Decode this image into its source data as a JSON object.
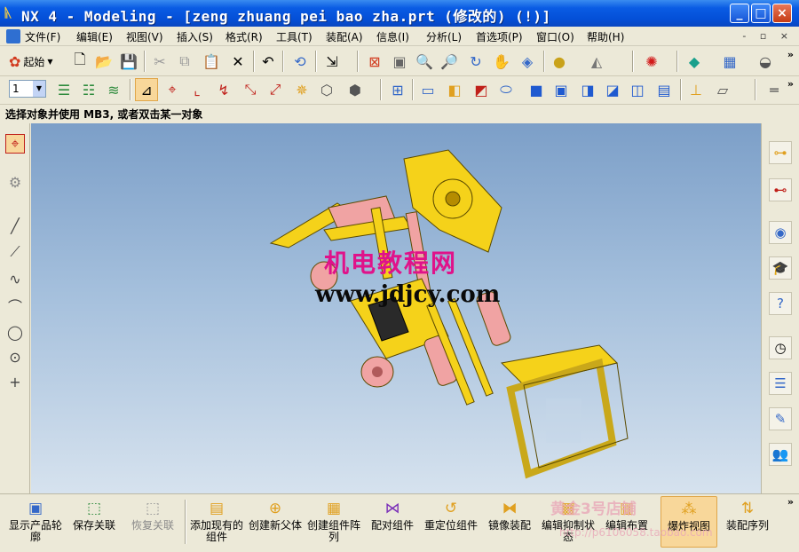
{
  "window": {
    "title": "NX 4 - Modeling - [zeng zhuang pei bao zha.prt  (修改的)      (!)]",
    "controls": {
      "minimize": "_",
      "maximize": "□",
      "close": "×"
    }
  },
  "menu": {
    "items": [
      "文件(F)",
      "编辑(E)",
      "视图(V)",
      "插入(S)",
      "格式(R)",
      "工具(T)",
      "装配(A)",
      "信息(I)",
      "分析(L)",
      "首选项(P)",
      "窗口(O)",
      "帮助(H)"
    ],
    "mdi_controls": "- ▫ ×"
  },
  "toolbar1": {
    "start_label": "起始"
  },
  "toolbar2": {
    "layer_value": "1"
  },
  "status_line": "选择对象并使用 MB3, 或者双击某一对象",
  "viewport": {
    "watermark_title": "机电教程网",
    "watermark_url": "www.jdjcy.com"
  },
  "assembly_toolbar": {
    "buttons": [
      {
        "label": "显示产品轮廓",
        "enabled": true
      },
      {
        "label": "保存关联",
        "enabled": true
      },
      {
        "label": "恢复关联",
        "enabled": false
      },
      {
        "label": "添加现有的组件",
        "enabled": true
      },
      {
        "label": "创建新父体",
        "enabled": true
      },
      {
        "label": "创建组件阵列",
        "enabled": true
      },
      {
        "label": "配对组件",
        "enabled": true
      },
      {
        "label": "重定位组件",
        "enabled": true
      },
      {
        "label": "镜像装配",
        "enabled": true
      },
      {
        "label": "编辑抑制状态",
        "enabled": true
      },
      {
        "label": "编辑布置",
        "enabled": true
      },
      {
        "label": "爆炸视图",
        "enabled": true,
        "active": true
      },
      {
        "label": "装配序列",
        "enabled": true
      }
    ],
    "shop_watermark": "黄金3号店铺",
    "shop_watermark_url": "http://p6106058.taobao.com"
  },
  "colors": {
    "title_bar": "#0a5ce4",
    "viewport_top": "#7c9fc8",
    "viewport_bottom": "#d6e2ee",
    "model_yellow": "#f5d21a",
    "model_pink": "#f0a3a3",
    "watermark_magenta": "#e0128a",
    "active_button": "#f8d79a"
  }
}
